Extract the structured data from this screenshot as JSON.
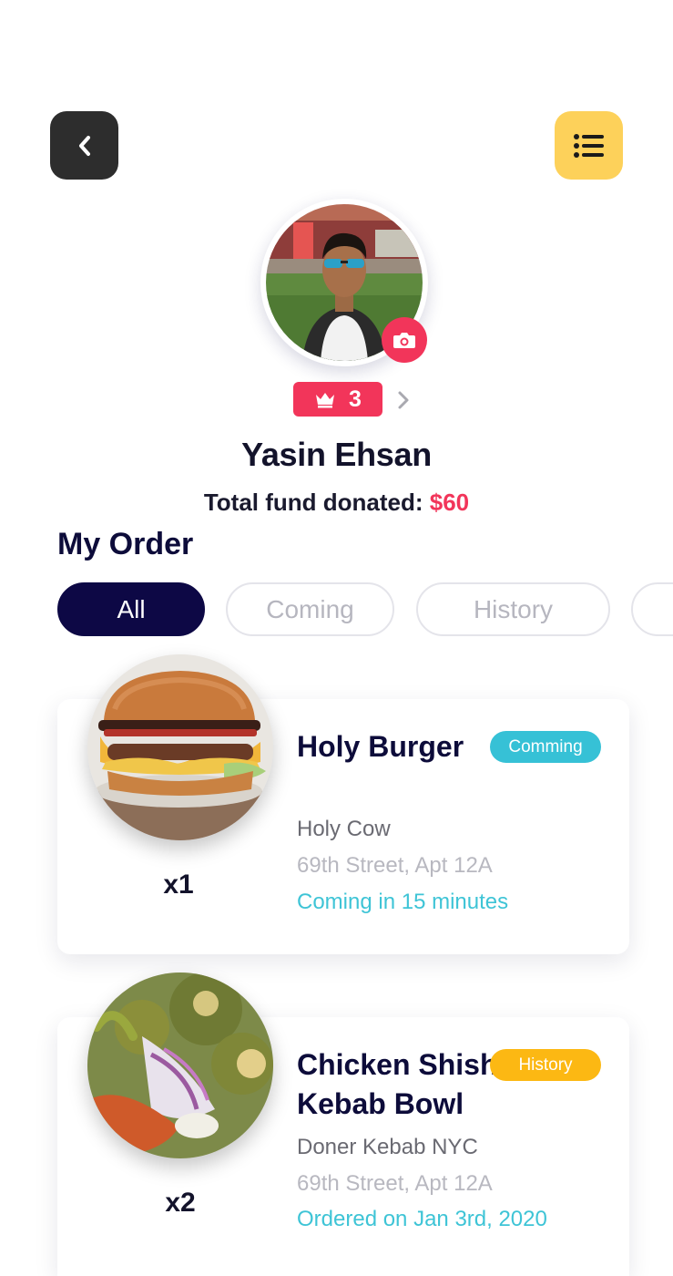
{
  "header": {
    "back_icon": "chevron-left-icon",
    "menu_icon": "list-menu-icon",
    "colors": {
      "back_bg": "#2d2d2d",
      "menu_bg": "#fdd15a"
    }
  },
  "profile": {
    "name": "Yasin Ehsan",
    "level": "3",
    "level_icon": "crown-icon",
    "camera_icon": "camera-icon",
    "fund_label": "Total fund donated: ",
    "fund_amount": "$60",
    "colors": {
      "accent": "#f2355a"
    }
  },
  "orders": {
    "title": "My Order",
    "tabs": [
      {
        "label": "All",
        "active": true
      },
      {
        "label": "Coming",
        "active": false
      },
      {
        "label": "History",
        "active": false
      },
      {
        "label": "",
        "active": false
      }
    ],
    "items": [
      {
        "title": "Holy Burger",
        "status": "Comming",
        "status_color": "#36c1d6",
        "restaurant": "Holy Cow",
        "address": "69th Street, Apt 12A",
        "status_text": "Coming in 15 minutes",
        "quantity": "x1"
      },
      {
        "title_line1": "Chicken Shish",
        "title_line2": "Kebab Bowl",
        "status": "History",
        "status_color": "#fcb813",
        "restaurant": "Doner Kebab NYC",
        "address": "69th Street, Apt 12A",
        "status_text": "Ordered on Jan 3rd, 2020",
        "quantity": "x2"
      }
    ]
  }
}
